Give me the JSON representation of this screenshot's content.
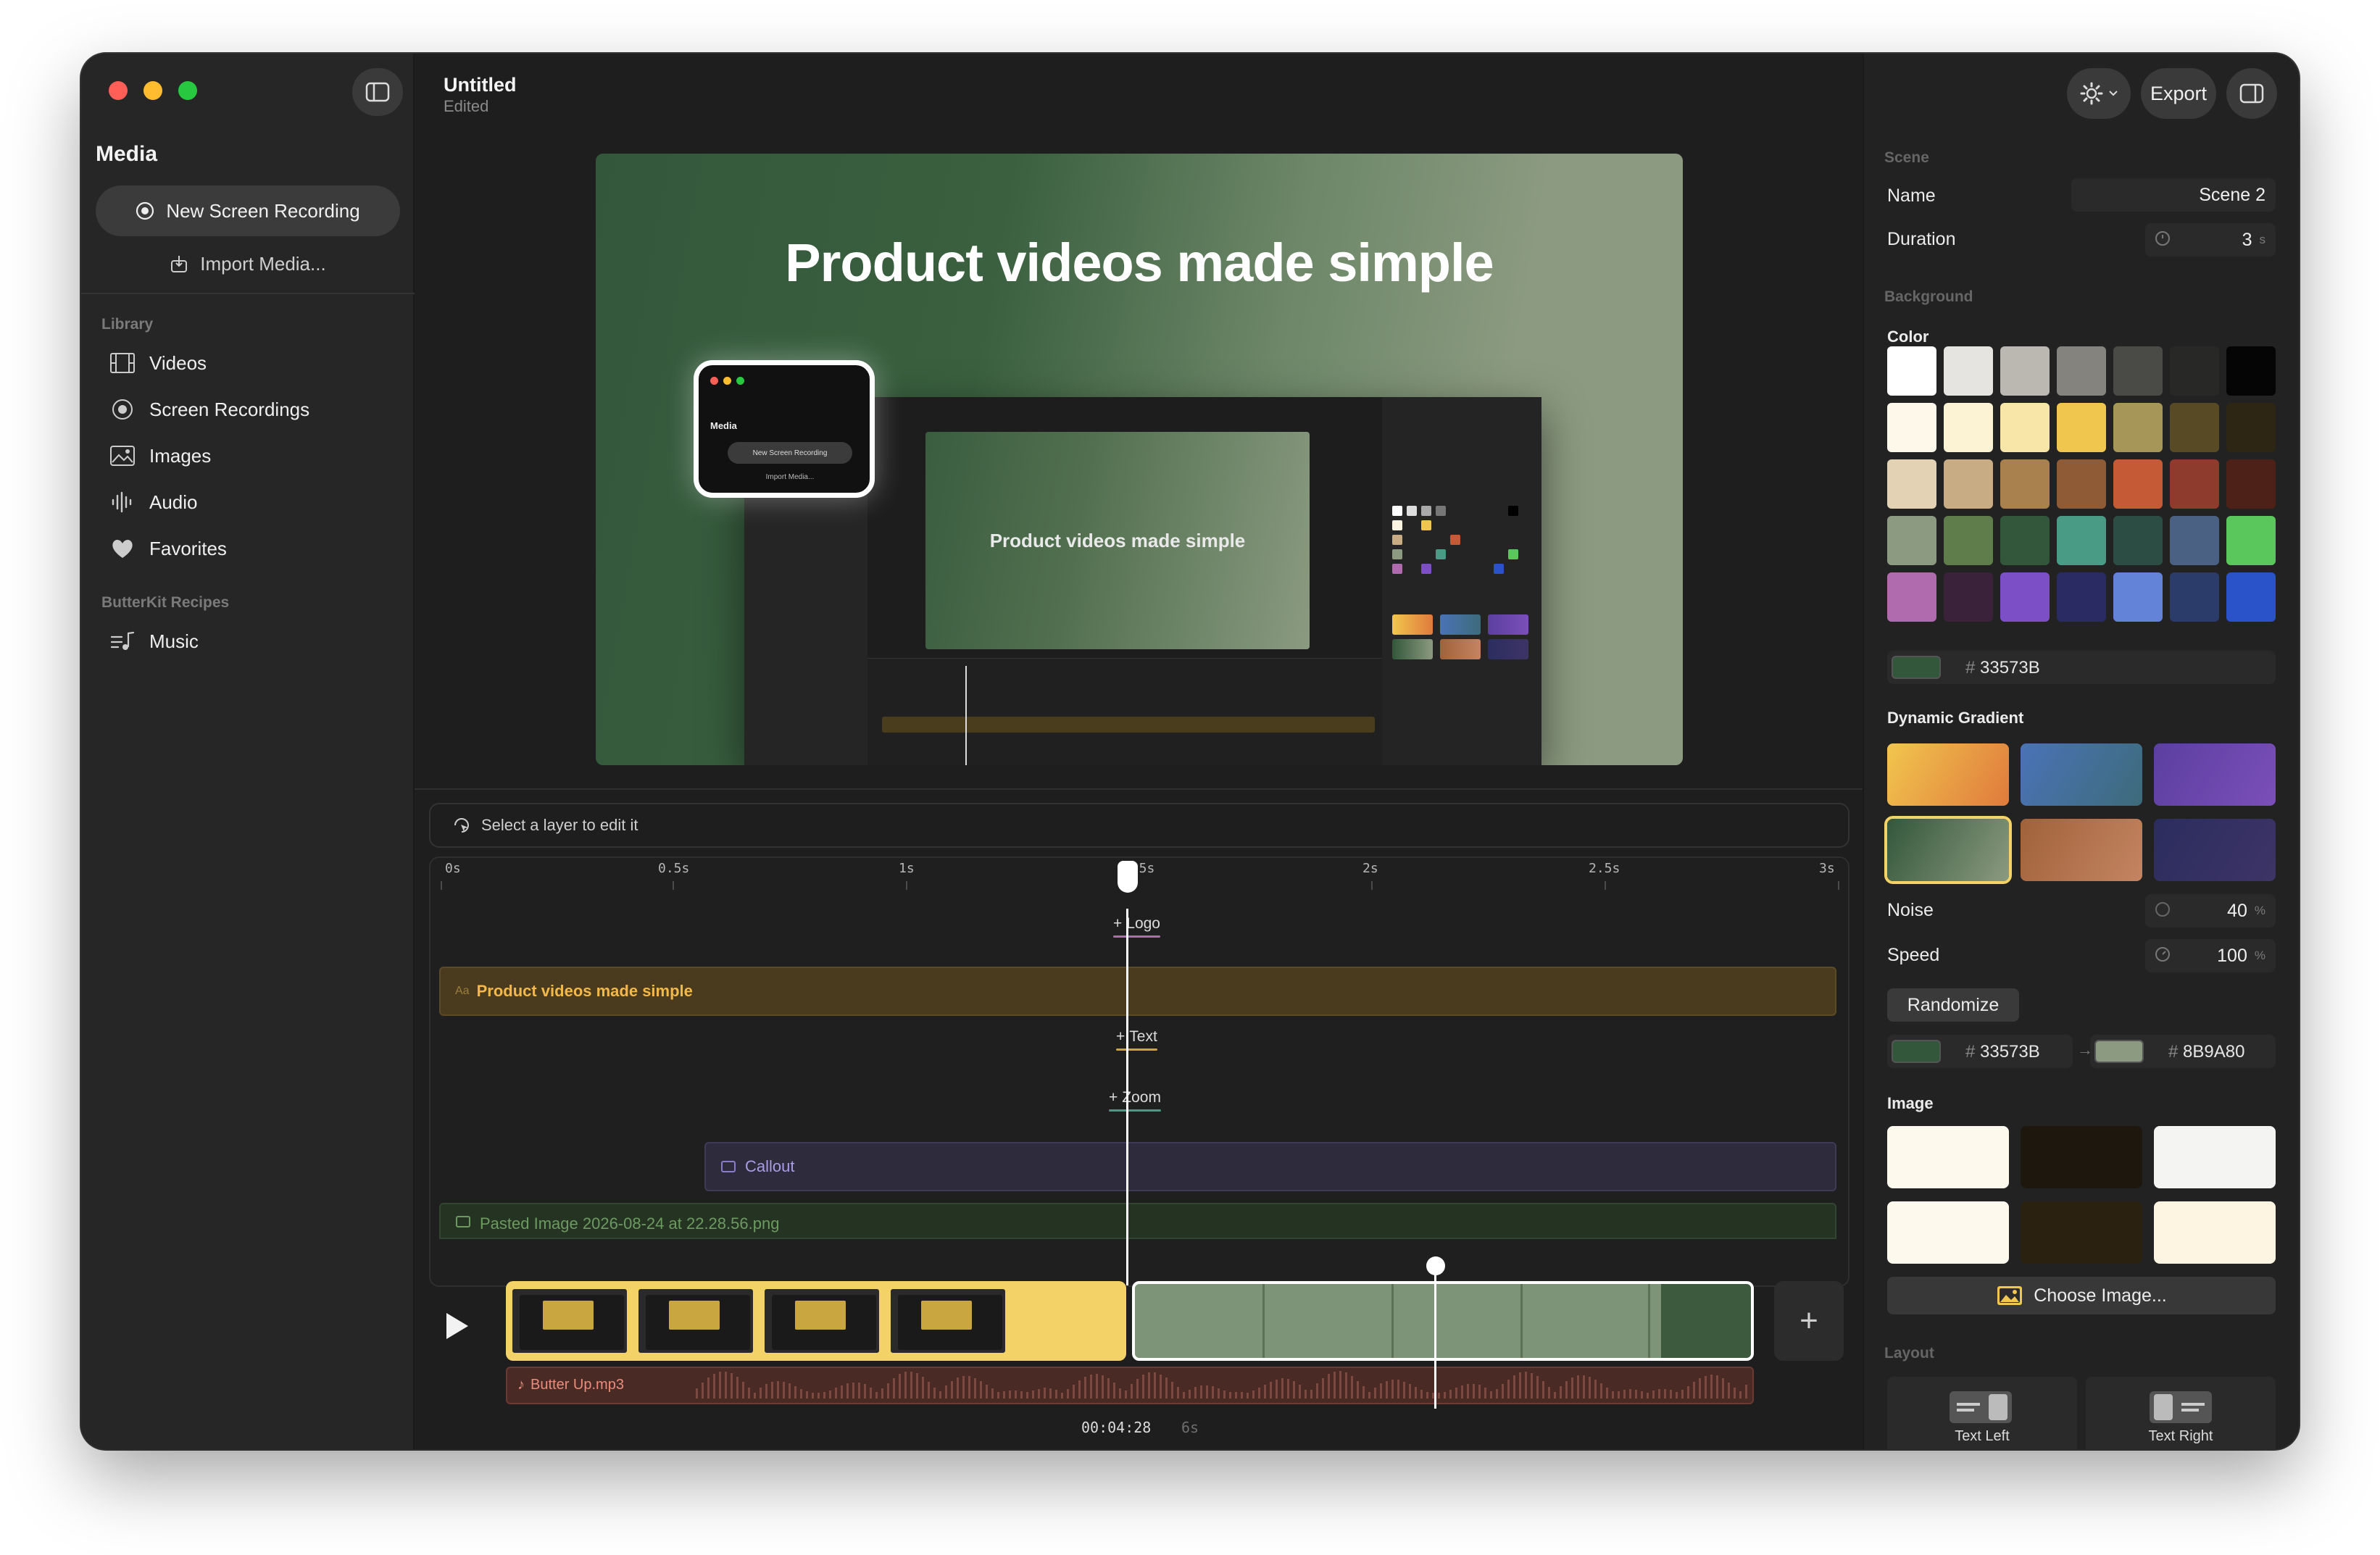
{
  "window": {
    "title": "Untitled",
    "subtitle": "Edited"
  },
  "sidebar": {
    "title": "Media",
    "new_recording": "New Screen Recording",
    "import_media": "Import Media...",
    "library_label": "Library",
    "library_items": [
      {
        "label": "Videos",
        "icon": "film-icon"
      },
      {
        "label": "Screen Recordings",
        "icon": "record-icon"
      },
      {
        "label": "Images",
        "icon": "photo-icon"
      },
      {
        "label": "Audio",
        "icon": "waveform-icon"
      },
      {
        "label": "Favorites",
        "icon": "heart-icon"
      }
    ],
    "recipes_label": "ButterKit Recipes",
    "recipes_items": [
      {
        "label": "Music",
        "icon": "music-list-icon"
      }
    ]
  },
  "preview": {
    "headline": "Product videos made simple",
    "mini_headline": "Product videos made simple",
    "mini_media": "Media",
    "mini_new_recording": "New Screen Recording",
    "mini_import": "Import Media..."
  },
  "timeline": {
    "hint": "Select a layer to edit it",
    "ticks": [
      "0s",
      "0.5s",
      "1s",
      "1.5s",
      "2s",
      "2.5s",
      "3s"
    ],
    "add_logo": "Logo",
    "add_text": "Text",
    "add_zoom": "Zoom",
    "text_clip": "Product videos made simple",
    "text_clip_prefix": "Aa",
    "callout_clip": "Callout",
    "image_clip": "Pasted Image 2026-08-24 at 22.28.56.png",
    "audio_clip": "Butter Up.mp3",
    "current_time": "00:04:28",
    "total_duration": "6s"
  },
  "inspector": {
    "export_label": "Export",
    "scene_section": "Scene",
    "name_label": "Name",
    "name_value": "Scene 2",
    "duration_label": "Duration",
    "duration_value": "3",
    "duration_unit": "s",
    "background_section": "Background",
    "color_label": "Color",
    "colors": [
      [
        "#ffffff",
        "#e5e4e0",
        "#bab8b1",
        "#84837d",
        "#4a4a46",
        "#282826",
        "#050505"
      ],
      [
        "#fdf8ea",
        "#fbf3d3",
        "#f7e6a8",
        "#f1c64e",
        "#a69758",
        "#574a25",
        "#2e2614"
      ],
      [
        "#e3d2b4",
        "#c8ac84",
        "#a8814f",
        "#8f5a36",
        "#c45a36",
        "#8e3a2c",
        "#4e2118"
      ],
      [
        "#8b9a80",
        "#5e7d4b",
        "#33573b",
        "#4a9b85",
        "#2c4d44",
        "#4b6183",
        "#5ac75c"
      ],
      [
        "#b06bae",
        "#3a233a",
        "#7c4fc6",
        "#2b2b64",
        "#6383d8",
        "#2b3b6a",
        "#2a52c9"
      ]
    ],
    "hex_value": "33573B",
    "hex_chip": "#33573b",
    "dynamic_gradient_label": "Dynamic Gradient",
    "gradients": [
      [
        "#f1c64e",
        "#e07a3c"
      ],
      [
        "#4a73b7",
        "#3d6b7a"
      ],
      [
        "#5b3fa0",
        "#7b4fb8"
      ],
      [
        "#33573b",
        "#8b9a80"
      ],
      [
        "#a0623a",
        "#c48462"
      ],
      [
        "#2b2d5e",
        "#3e3466"
      ]
    ],
    "noise_label": "Noise",
    "noise_value": "40",
    "noise_unit": "%",
    "speed_label": "Speed",
    "speed_value": "100",
    "speed_unit": "%",
    "randomize_label": "Randomize",
    "gradient_from": "33573B",
    "gradient_from_color": "#33573b",
    "gradient_to": "8B9A80",
    "gradient_to_color": "#8b9a80",
    "image_label": "Image",
    "images": [
      "#fdf9ec",
      "#1e170e",
      "#f4f4f2",
      "#fdf9ec",
      "#2b2110",
      "#fdf5e2"
    ],
    "choose_image_label": "Choose Image...",
    "layout_section": "Layout",
    "layout_options": [
      "Text Left",
      "Text Right"
    ]
  },
  "colors": {
    "accent_text_clip": "#f2b94a",
    "callout": "#a99be6",
    "audio": "#e98d7b"
  }
}
